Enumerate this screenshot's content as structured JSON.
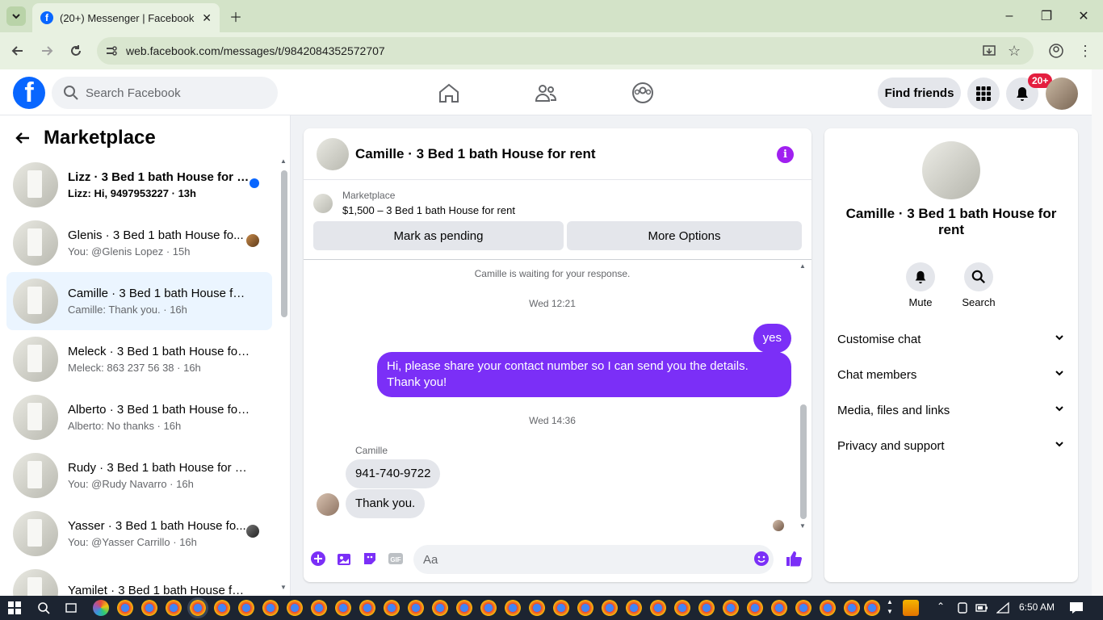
{
  "browser": {
    "tab_title": "(20+) Messenger | Facebook",
    "favicon": "f",
    "url": "web.facebook.com/messages/t/9842084352572707"
  },
  "header": {
    "logo": "f",
    "search_placeholder": "Search Facebook",
    "find_friends": "Find friends",
    "notification_badge": "20+"
  },
  "sidebar": {
    "title": "Marketplace",
    "conversations": [
      {
        "name": "Lizz · 3 Bed 1 bath House for r...",
        "message": "Lizz: Hi, 9497953227 · 13h",
        "unread": true
      },
      {
        "name": "Glenis · 3 Bed 1 bath House fo...",
        "message": "You: @Glenis Lopez · 15h",
        "unread": false
      },
      {
        "name": "Camille · 3 Bed 1 bath House for...",
        "message": "Camille: Thank you. · 16h",
        "unread": false,
        "active": true
      },
      {
        "name": "Meleck · 3 Bed 1 bath House for ...",
        "message": "Meleck: 863 237 56 38 · 16h",
        "unread": false
      },
      {
        "name": "Alberto · 3 Bed 1 bath House for...",
        "message": "Alberto: No thanks · 16h",
        "unread": false
      },
      {
        "name": "Rudy · 3 Bed 1 bath House for re...",
        "message": "You: @Rudy Navarro · 16h",
        "unread": false
      },
      {
        "name": "Yasser · 3 Bed 1 bath House fo...",
        "message": "You: @Yasser Carrillo · 16h",
        "unread": false
      },
      {
        "name": "Yamilet · 3 Bed 1 bath House for ...",
        "message": "",
        "unread": false
      }
    ]
  },
  "chat": {
    "title": "Camille · 3 Bed 1 bath House for rent",
    "info_icon": "i",
    "marketplace_label": "Marketplace",
    "listing": "$1,500 – 3 Bed 1 bath House for rent",
    "mark_pending": "Mark as pending",
    "more_options": "More Options",
    "waiting": "Camille is waiting for your response.",
    "timestamp1": "Wed 12:21",
    "out_msg1": "yes",
    "out_msg2": "Hi, please share your contact number so I can send you the details. Thank you!",
    "timestamp2": "Wed 14:36",
    "sender": "Camille",
    "in_msg1": "941-740-9722",
    "in_msg2": "Thank you.",
    "input_placeholder": "Aa"
  },
  "details": {
    "name": "Camille · 3 Bed 1 bath House for rent",
    "mute": "Mute",
    "search": "Search",
    "sections": [
      "Customise chat",
      "Chat members",
      "Media, files and links",
      "Privacy and support"
    ]
  },
  "taskbar": {
    "time": "6:50 AM"
  },
  "colors": {
    "accent": "#7b2ff7",
    "fb_blue": "#0866ff",
    "badge_red": "#e41e3f",
    "chrome_green": "#d3e3c8"
  }
}
